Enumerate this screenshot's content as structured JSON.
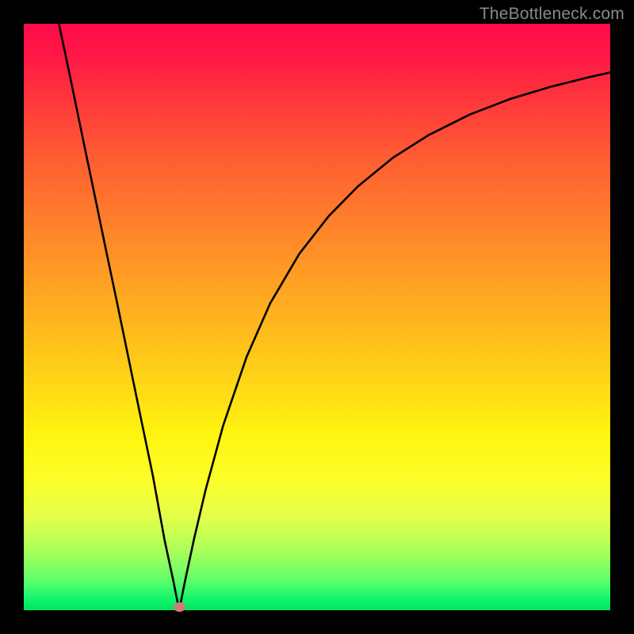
{
  "watermark": "TheBottleneck.com",
  "chart_data": {
    "type": "line",
    "title": "",
    "xlabel": "",
    "ylabel": "",
    "xlim": [
      0,
      1
    ],
    "ylim": [
      0,
      1
    ],
    "grid": false,
    "legend": false,
    "minimum_marker": {
      "x": 0.265,
      "y": 0.0,
      "color": "#d17a7a"
    },
    "series": [
      {
        "name": "curve",
        "color": "#000000",
        "x": [
          0.06,
          0.08,
          0.1,
          0.12,
          0.14,
          0.16,
          0.18,
          0.2,
          0.22,
          0.24,
          0.255,
          0.262,
          0.265,
          0.268,
          0.275,
          0.29,
          0.31,
          0.34,
          0.38,
          0.42,
          0.47,
          0.52,
          0.57,
          0.63,
          0.69,
          0.76,
          0.83,
          0.9,
          0.96,
          1.0
        ],
        "y": [
          1.0,
          0.905,
          0.808,
          0.712,
          0.615,
          0.52,
          0.423,
          0.326,
          0.23,
          0.12,
          0.05,
          0.015,
          0.0,
          0.015,
          0.05,
          0.12,
          0.205,
          0.315,
          0.432,
          0.523,
          0.608,
          0.672,
          0.723,
          0.772,
          0.81,
          0.845,
          0.872,
          0.893,
          0.908,
          0.917
        ]
      }
    ]
  }
}
